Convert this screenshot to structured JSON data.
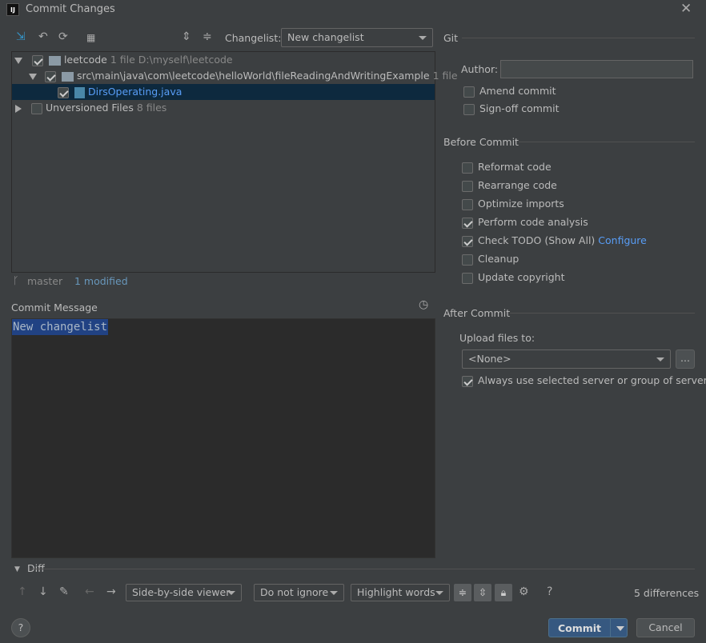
{
  "window": {
    "title": "Commit Changes",
    "app_icon": "IJ"
  },
  "toolbar": {
    "changelist_label": "Changelist:",
    "changelist_value": "New changelist"
  },
  "tree": {
    "root": {
      "name": "leetcode",
      "count": "1 file",
      "path": "D:\\myself\\leetcode"
    },
    "folder": {
      "name": "src\\main\\java\\com\\leetcode\\helloWorld\\fileReadingAndWritingExample",
      "count": "1 file"
    },
    "file": {
      "name": "DirsOperating.java"
    },
    "unversioned": {
      "name": "Unversioned Files",
      "count": "8 files"
    }
  },
  "status": {
    "branch": "master",
    "modified": "1 modified"
  },
  "commit_message": {
    "label": "Commit Message",
    "value": "New changelist"
  },
  "git": {
    "title": "Git",
    "author_label": "Author:",
    "author_value": "",
    "options": [
      {
        "label": "Amend commit",
        "checked": false
      },
      {
        "label": "Sign-off commit",
        "checked": false
      }
    ]
  },
  "before_commit": {
    "title": "Before Commit",
    "options": [
      {
        "label": "Reformat code",
        "checked": false
      },
      {
        "label": "Rearrange code",
        "checked": false
      },
      {
        "label": "Optimize imports",
        "checked": false
      },
      {
        "label": "Perform code analysis",
        "checked": true
      },
      {
        "label": "Check TODO (Show All)",
        "checked": true,
        "link": "Configure"
      },
      {
        "label": "Cleanup",
        "checked": false
      },
      {
        "label": "Update copyright",
        "checked": false
      }
    ]
  },
  "after_commit": {
    "title": "After Commit",
    "upload_label": "Upload files to:",
    "upload_value": "<None>",
    "browse_label": "...",
    "always_label": "Always use selected server or group of servers",
    "always_checked": true
  },
  "diff": {
    "title": "Diff",
    "viewer": "Side-by-side viewer",
    "ignore": "Do not ignore",
    "highlight": "Highlight words",
    "help": "?",
    "differences": "5 differences"
  },
  "footer": {
    "help": "?",
    "commit": "Commit",
    "cancel": "Cancel"
  }
}
